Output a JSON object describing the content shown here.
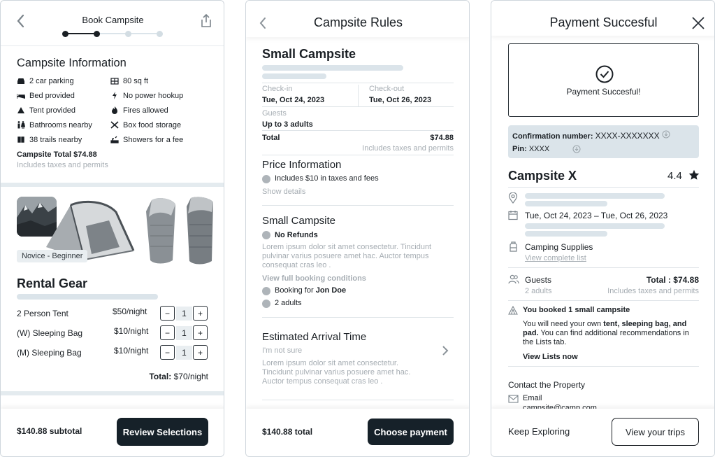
{
  "book_campsite": {
    "title": "Book Campsite",
    "campsite_info": {
      "heading": "Campsite Information",
      "amenities_left": [
        "2 car parking",
        "Bed provided",
        "Tent provided",
        "Bathrooms nearby",
        "38 trails nearby"
      ],
      "amenities_right": [
        "80 sq ft",
        "No power hookup",
        "Fires allowed",
        "Box food storage",
        "Showers for a fee"
      ],
      "total": "Campsite Total $74.88",
      "total_note": "Includes taxes and permits"
    },
    "rental_gear": {
      "badge": "Novice - Beginner",
      "heading": "Rental Gear",
      "items": [
        {
          "name": "2 Person Tent",
          "price": "$50/night",
          "qty": "1"
        },
        {
          "name": "(W) Sleeping Bag",
          "price": "$10/night",
          "qty": "1"
        },
        {
          "name": "(M) Sleeping Bag",
          "price": "$10/night",
          "qty": "1"
        }
      ],
      "total_label": "Total:",
      "total_value": "$70/night"
    },
    "footer": {
      "subtotal": "$140.88 subtotal",
      "button": "Review Selections"
    }
  },
  "rules": {
    "title": "Campsite Rules",
    "site_name": "Small Campsite",
    "checkin_label": "Check-in",
    "checkin_value": "Tue, Oct 24, 2023",
    "checkout_label": "Check-out",
    "checkout_value": "Tue, Oct 26, 2023",
    "guests_label": "Guests",
    "guests_value": "Up to 3 adults",
    "total_label": "Total",
    "total_value": "$74.88",
    "total_note": "Includes taxes and permits",
    "price_heading": "Price Information",
    "price_item": "Includes $10 in taxes and fees",
    "show_details": "Show details",
    "small_heading": "Small Campsite",
    "no_refunds": "No Refunds",
    "lorem1": "Lorem ipsum dolor sit amet consectetur. Tincidunt pulvinar varius posuere amet hac. Auctor tempus consequat cras leo .",
    "view_conditions": "View full booking conditions",
    "booking_for_prefix": "Booking for ",
    "booking_for_name": "Jon Doe",
    "adults": "2 adults",
    "arrival_heading": "Estimated Arrival Time",
    "not_sure": "I'm not sure",
    "lorem2": "Lorem ipsum dolor sit amet consectetur. Tincidunt pulvinar varius posuere amet hac. Auctor tempus consequat cras leo .",
    "footer": {
      "total": "$140.88 total",
      "button": "Choose payment"
    }
  },
  "payment": {
    "title": "Payment Succesful",
    "success_message": "Payment Succesful!",
    "confirmation_label": "Confirmation number:",
    "confirmation_value": "XXXX-XXXXXXX",
    "pin_label": "Pin:",
    "pin_value": "XXXX",
    "campsite_name": "Campsite X",
    "rating": "4.4",
    "dates": "Tue, Oct 24, 2023 – Tue, Oct 26, 2023",
    "supplies_heading": "Camping Supplies",
    "supplies_link": "View complete list",
    "guests_label": "Guests",
    "guests_value": "2 adults",
    "total": "Total : $74.88",
    "total_note": "Includes taxes and permits",
    "booked_title": "You booked 1 small campsite",
    "booked_text_1": "You will need your own ",
    "booked_text_bold": "tent, sleeping bag, and pad.",
    "booked_text_2": " You can find additional recommendations in the Lists tab.",
    "view_lists": "View Lists now",
    "contact_heading": "Contact the Property",
    "email_label": "Email",
    "email_value": "campsite@camp.com",
    "footer": {
      "keep_exploring": "Keep Exploring",
      "view_trips": "View your trips"
    }
  },
  "colors": {
    "dark": "#162129",
    "placeholder": "#dbe4ea",
    "muted": "#a6adb3"
  }
}
